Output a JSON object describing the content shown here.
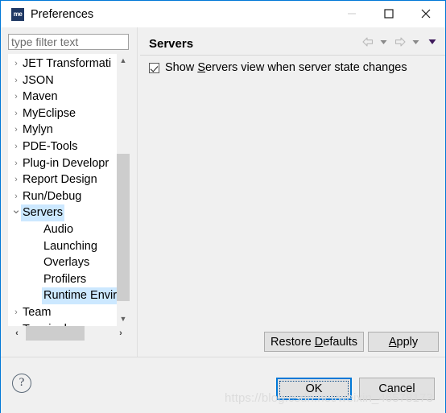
{
  "window": {
    "title": "Preferences",
    "icon": "me",
    "controls": {
      "minimize": "minimize-icon",
      "maximize": "maximize-icon",
      "close": "close-icon"
    }
  },
  "filter": {
    "placeholder": "type filter text",
    "value": ""
  },
  "tree": {
    "items": [
      {
        "label": "JET Transformati",
        "level": 1,
        "expandable": true,
        "expanded": false,
        "selected": false
      },
      {
        "label": "JSON",
        "level": 1,
        "expandable": true,
        "expanded": false,
        "selected": false
      },
      {
        "label": "Maven",
        "level": 1,
        "expandable": true,
        "expanded": false,
        "selected": false
      },
      {
        "label": "MyEclipse",
        "level": 1,
        "expandable": true,
        "expanded": false,
        "selected": false
      },
      {
        "label": "Mylyn",
        "level": 1,
        "expandable": true,
        "expanded": false,
        "selected": false
      },
      {
        "label": "PDE-Tools",
        "level": 1,
        "expandable": true,
        "expanded": false,
        "selected": false
      },
      {
        "label": "Plug-in Developr",
        "level": 1,
        "expandable": true,
        "expanded": false,
        "selected": false
      },
      {
        "label": "Report Design",
        "level": 1,
        "expandable": true,
        "expanded": false,
        "selected": false
      },
      {
        "label": "Run/Debug",
        "level": 1,
        "expandable": true,
        "expanded": false,
        "selected": false
      },
      {
        "label": "Servers",
        "level": 1,
        "expandable": true,
        "expanded": true,
        "selected": true
      },
      {
        "label": "Audio",
        "level": 2,
        "expandable": false,
        "expanded": false,
        "selected": false
      },
      {
        "label": "Launching",
        "level": 2,
        "expandable": false,
        "expanded": false,
        "selected": false
      },
      {
        "label": "Overlays",
        "level": 2,
        "expandable": false,
        "expanded": false,
        "selected": false
      },
      {
        "label": "Profilers",
        "level": 2,
        "expandable": false,
        "expanded": false,
        "selected": false
      },
      {
        "label": "Runtime Envir",
        "level": 2,
        "expandable": false,
        "expanded": false,
        "selected": true
      },
      {
        "label": "Team",
        "level": 1,
        "expandable": true,
        "expanded": false,
        "selected": false
      },
      {
        "label": "Terminal",
        "level": 1,
        "expandable": true,
        "expanded": false,
        "selected": false
      }
    ],
    "scroll_up_icon": "chevron-up-icon",
    "scroll_down_icon": "chevron-down-icon",
    "scroll_left_icon": "chevron-left-icon",
    "scroll_right_icon": "chevron-right-icon"
  },
  "page": {
    "title": "Servers",
    "nav": {
      "back_icon": "back-arrow-icon",
      "back_menu_icon": "chevron-down-icon",
      "forward_icon": "forward-arrow-icon",
      "forward_menu_icon": "chevron-down-icon",
      "view_menu_icon": "chevron-down-icon"
    },
    "checkbox": {
      "checked": true,
      "label_before": "Show ",
      "label_mnemonic": "S",
      "label_after": "ervers view when server state changes",
      "full_label": "Show Servers view when server state changes"
    },
    "restore_defaults": {
      "before": "Restore ",
      "mnemonic": "D",
      "after": "efaults",
      "full": "Restore Defaults"
    },
    "apply": {
      "before": "",
      "mnemonic": "A",
      "after": "pply",
      "full": "Apply"
    }
  },
  "footer": {
    "help_label": "?",
    "ok_label": "OK",
    "cancel_label": "Cancel"
  },
  "watermark": "https://blog.csdn.net/weixin_46578173",
  "colors": {
    "accent": "#0078d7",
    "selection": "#cce8ff",
    "dialog_bg": "#f0f0f0",
    "scrollbar_thumb": "#cdcdcd"
  }
}
